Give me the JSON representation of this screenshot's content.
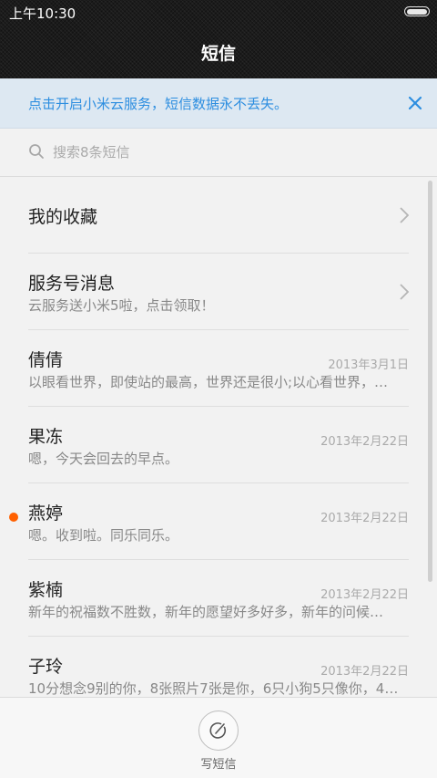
{
  "status_bar": {
    "time": "上午10:30",
    "battery_icon": "battery-icon"
  },
  "header": {
    "title": "短信"
  },
  "cloud_banner": {
    "text": "点击开启小米云服务，短信数据永不丢失。",
    "close_icon": "close-icon",
    "accent_color": "#2d8ee0"
  },
  "search": {
    "placeholder": "搜索8条短信",
    "icon": "search-icon"
  },
  "conversations": [
    {
      "name": "我的收藏",
      "preview": "",
      "date": ""
    },
    {
      "name": "服务号消息",
      "preview": "云服务送小米5啦，点击领取！",
      "date": ""
    },
    {
      "name": "倩倩",
      "preview": "以眼看世界，即使站的最高，世界还是很小;以心看世界，…",
      "date": "2013年3月1日"
    },
    {
      "name": "果冻",
      "preview": "嗯，今天会回去的早点。",
      "date": "2013年2月22日"
    },
    {
      "name": "燕婷",
      "preview": "嗯。收到啦。同乐同乐。",
      "date": "2013年2月22日",
      "unread": true
    },
    {
      "name": "紫楠",
      "preview": "新年的祝福数不胜数，新年的愿望好多好多，新年的问候…",
      "date": "2013年2月22日"
    },
    {
      "name": "子玲",
      "preview": "10分想念9别的你，8张照片7张是你，6只小狗5只像你，4…",
      "date": "2013年2月22日"
    }
  ],
  "unread_dot_color": "#ff6000",
  "bottom_bar": {
    "compose_label": "写短信",
    "compose_icon": "compose-icon"
  }
}
